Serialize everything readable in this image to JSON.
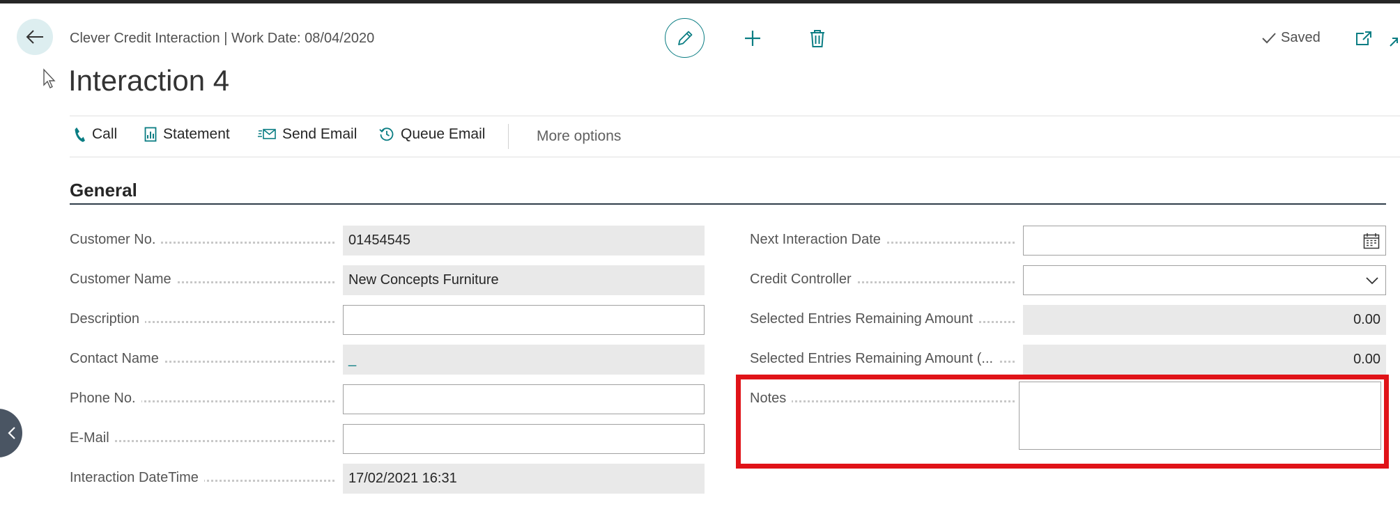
{
  "header": {
    "breadcrumb": "Clever Credit Interaction | Work Date: 08/04/2020",
    "page_title": "Interaction 4",
    "status": "Saved"
  },
  "actions": {
    "call": "Call",
    "statement": "Statement",
    "send_email": "Send Email",
    "queue_email": "Queue Email",
    "more_options": "More options"
  },
  "section": {
    "title": "General"
  },
  "left_fields": {
    "customer_no": {
      "label": "Customer No.",
      "value": "01454545"
    },
    "customer_name": {
      "label": "Customer Name",
      "value": "New Concepts Furniture"
    },
    "description": {
      "label": "Description",
      "value": ""
    },
    "contact_name": {
      "label": "Contact Name",
      "value": "_"
    },
    "phone_no": {
      "label": "Phone No.",
      "value": ""
    },
    "email": {
      "label": "E-Mail",
      "value": ""
    },
    "interaction_datetime": {
      "label": "Interaction DateTime",
      "value": "17/02/2021 16:31"
    }
  },
  "right_fields": {
    "next_interaction_date": {
      "label": "Next Interaction Date",
      "value": ""
    },
    "credit_controller": {
      "label": "Credit Controller",
      "value": ""
    },
    "sel_remaining": {
      "label": "Selected Entries Remaining Amount",
      "value": "0.00"
    },
    "sel_remaining_lcy": {
      "label": "Selected Entries Remaining Amount (...",
      "value": "0.00"
    },
    "notes": {
      "label": "Notes",
      "value": ""
    }
  },
  "colors": {
    "accent": "#0a7d83",
    "highlight": "#e01318",
    "readonly_bg": "#e9e9e9"
  }
}
